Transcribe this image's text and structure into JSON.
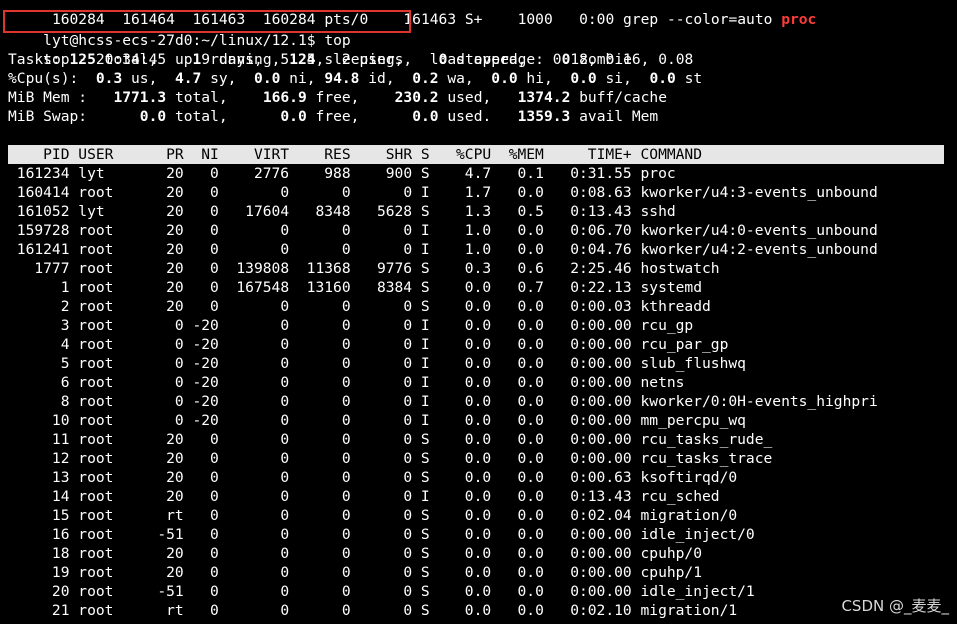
{
  "prev_line": {
    "text": " 160284  161464  161463  160284 pts/0    161463 S+    1000   0:00 grep --color=auto ",
    "highlight": "proc"
  },
  "prompt": {
    "text": "lyt@hcss-ecs-27d0:~/linux/12.1$ top"
  },
  "summary": {
    "uptime": "top - 20:34:45 up 9 days,  5:25,  2 users,  load average: 0.18, 0.16, 0.08",
    "tasks": {
      "label": "Tasks: ",
      "total": "125",
      "total_label": " total,    ",
      "running": "1",
      "running_label": " running, ",
      "sleeping": "124",
      "sleeping_label": " sleeping,    ",
      "stopped": "0",
      "stopped_label": " stopped,    ",
      "zombie": "0",
      "zombie_label": " zombie"
    },
    "cpu": {
      "label": "%Cpu(s):  ",
      "us": "0.3",
      "us_label": " us,  ",
      "sy": "4.7",
      "sy_label": " sy,  ",
      "ni": "0.0",
      "ni_label": " ni, ",
      "id": "94.8",
      "id_label": " id,  ",
      "wa": "0.2",
      "wa_label": " wa,  ",
      "hi": "0.0",
      "hi_label": " hi,  ",
      "si": "0.0",
      "si_label": " si,  ",
      "st": "0.0",
      "st_label": " st"
    },
    "mem": {
      "label": "MiB Mem :   ",
      "total": "1771.3",
      "total_label": " total,    ",
      "free": "166.9",
      "free_label": " free,    ",
      "used": "230.2",
      "used_label": " used,   ",
      "cache": "1374.2",
      "cache_label": " buff/cache"
    },
    "swap": {
      "label": "MiB Swap:      ",
      "total": "0.0",
      "total_label": " total,      ",
      "free": "0.0",
      "free_label": " free,      ",
      "used": "0.0",
      "used_label": " used.   ",
      "avail": "1359.3",
      "avail_label": " avail Mem"
    }
  },
  "table": {
    "headers": [
      "PID",
      "USER",
      "PR",
      "NI",
      "VIRT",
      "RES",
      "SHR",
      "S",
      "%CPU",
      "%MEM",
      "TIME+",
      "COMMAND"
    ],
    "rows": [
      [
        "161234",
        "lyt",
        "20",
        "0",
        "2776",
        "988",
        "900",
        "S",
        "4.7",
        "0.1",
        "0:31.55",
        "proc"
      ],
      [
        "160414",
        "root",
        "20",
        "0",
        "0",
        "0",
        "0",
        "I",
        "1.7",
        "0.0",
        "0:08.63",
        "kworker/u4:3-events_unbound"
      ],
      [
        "161052",
        "lyt",
        "20",
        "0",
        "17604",
        "8348",
        "5628",
        "S",
        "1.3",
        "0.5",
        "0:13.43",
        "sshd"
      ],
      [
        "159728",
        "root",
        "20",
        "0",
        "0",
        "0",
        "0",
        "I",
        "1.0",
        "0.0",
        "0:06.70",
        "kworker/u4:0-events_unbound"
      ],
      [
        "161241",
        "root",
        "20",
        "0",
        "0",
        "0",
        "0",
        "I",
        "1.0",
        "0.0",
        "0:04.76",
        "kworker/u4:2-events_unbound"
      ],
      [
        "1777",
        "root",
        "20",
        "0",
        "139808",
        "11368",
        "9776",
        "S",
        "0.3",
        "0.6",
        "2:25.46",
        "hostwatch"
      ],
      [
        "1",
        "root",
        "20",
        "0",
        "167548",
        "13160",
        "8384",
        "S",
        "0.0",
        "0.7",
        "0:22.13",
        "systemd"
      ],
      [
        "2",
        "root",
        "20",
        "0",
        "0",
        "0",
        "0",
        "S",
        "0.0",
        "0.0",
        "0:00.03",
        "kthreadd"
      ],
      [
        "3",
        "root",
        "0",
        "-20",
        "0",
        "0",
        "0",
        "I",
        "0.0",
        "0.0",
        "0:00.00",
        "rcu_gp"
      ],
      [
        "4",
        "root",
        "0",
        "-20",
        "0",
        "0",
        "0",
        "I",
        "0.0",
        "0.0",
        "0:00.00",
        "rcu_par_gp"
      ],
      [
        "5",
        "root",
        "0",
        "-20",
        "0",
        "0",
        "0",
        "I",
        "0.0",
        "0.0",
        "0:00.00",
        "slub_flushwq"
      ],
      [
        "6",
        "root",
        "0",
        "-20",
        "0",
        "0",
        "0",
        "I",
        "0.0",
        "0.0",
        "0:00.00",
        "netns"
      ],
      [
        "8",
        "root",
        "0",
        "-20",
        "0",
        "0",
        "0",
        "I",
        "0.0",
        "0.0",
        "0:00.00",
        "kworker/0:0H-events_highpri"
      ],
      [
        "10",
        "root",
        "0",
        "-20",
        "0",
        "0",
        "0",
        "I",
        "0.0",
        "0.0",
        "0:00.00",
        "mm_percpu_wq"
      ],
      [
        "11",
        "root",
        "20",
        "0",
        "0",
        "0",
        "0",
        "S",
        "0.0",
        "0.0",
        "0:00.00",
        "rcu_tasks_rude_"
      ],
      [
        "12",
        "root",
        "20",
        "0",
        "0",
        "0",
        "0",
        "S",
        "0.0",
        "0.0",
        "0:00.00",
        "rcu_tasks_trace"
      ],
      [
        "13",
        "root",
        "20",
        "0",
        "0",
        "0",
        "0",
        "S",
        "0.0",
        "0.0",
        "0:00.63",
        "ksoftirqd/0"
      ],
      [
        "14",
        "root",
        "20",
        "0",
        "0",
        "0",
        "0",
        "I",
        "0.0",
        "0.0",
        "0:13.43",
        "rcu_sched"
      ],
      [
        "15",
        "root",
        "rt",
        "0",
        "0",
        "0",
        "0",
        "S",
        "0.0",
        "0.0",
        "0:02.04",
        "migration/0"
      ],
      [
        "16",
        "root",
        "-51",
        "0",
        "0",
        "0",
        "0",
        "S",
        "0.0",
        "0.0",
        "0:00.00",
        "idle_inject/0"
      ],
      [
        "18",
        "root",
        "20",
        "0",
        "0",
        "0",
        "0",
        "S",
        "0.0",
        "0.0",
        "0:00.00",
        "cpuhp/0"
      ],
      [
        "19",
        "root",
        "20",
        "0",
        "0",
        "0",
        "0",
        "S",
        "0.0",
        "0.0",
        "0:00.00",
        "cpuhp/1"
      ],
      [
        "20",
        "root",
        "-51",
        "0",
        "0",
        "0",
        "0",
        "S",
        "0.0",
        "0.0",
        "0:00.00",
        "idle_inject/1"
      ],
      [
        "21",
        "root",
        "rt",
        "0",
        "0",
        "0",
        "0",
        "S",
        "0.0",
        "0.0",
        "0:02.10",
        "migration/1"
      ]
    ]
  },
  "watermark": "CSDN @_麦麦_",
  "colors": {
    "background": "#000000",
    "foreground": "#ffffff",
    "header_bg": "#e6e6e6",
    "highlight_red": "#ff3b3b",
    "box_border": "#e0342f"
  }
}
